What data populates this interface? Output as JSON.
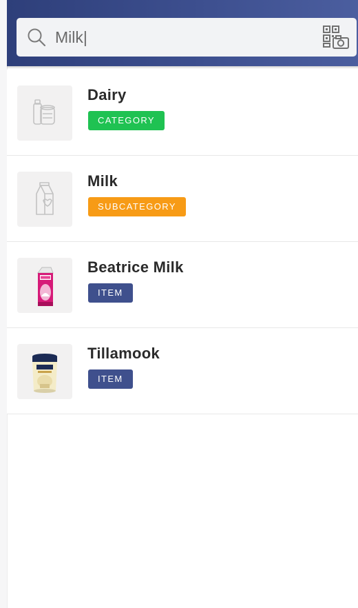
{
  "search": {
    "query": "Milk|",
    "search_icon": "search-icon",
    "scan_icon": "qr-camera-icon"
  },
  "colors": {
    "header": "#3d4f8f",
    "category": "#1fc252",
    "subcategory": "#f79b16",
    "item": "#3f508d"
  },
  "results": [
    {
      "title": "Dairy",
      "badge": "CATEGORY",
      "icon": "dairy-icon"
    },
    {
      "title": "Milk",
      "badge": "SUBCATEGORY",
      "icon": "milk-carton-icon"
    },
    {
      "title": "Beatrice Milk",
      "badge": "ITEM",
      "icon": "product-image"
    },
    {
      "title": "Tillamook",
      "badge": "ITEM",
      "icon": "product-image"
    }
  ]
}
